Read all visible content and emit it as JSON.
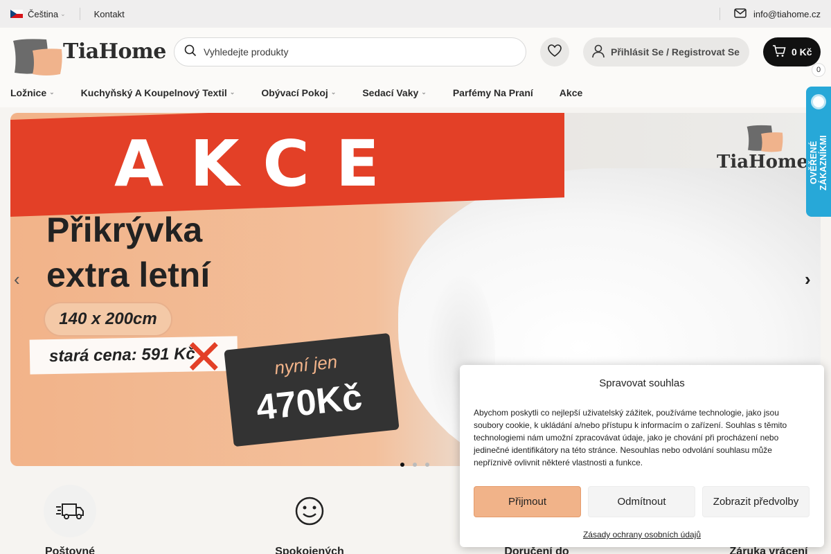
{
  "topbar": {
    "language": "Čeština",
    "contact": "Kontakt",
    "email": "info@tiahome.cz"
  },
  "header": {
    "logo_text": "TiaHome",
    "search_placeholder": "Vyhledejte produkty",
    "login_label": "Přihlásit Se / Registrovat Se",
    "cart_total": "0 Kč",
    "cart_count": "0"
  },
  "nav": {
    "items": [
      {
        "label": "Ložnice",
        "has_dropdown": true
      },
      {
        "label": "Kuchyňský A Koupelnový Textil",
        "has_dropdown": true
      },
      {
        "label": "Obývací Pokoj",
        "has_dropdown": true
      },
      {
        "label": "Sedací Vaky",
        "has_dropdown": true
      },
      {
        "label": "Parfémy Na Praní",
        "has_dropdown": false
      },
      {
        "label": "Akce",
        "has_dropdown": false
      }
    ]
  },
  "hero": {
    "headline": "AKCE",
    "title_line1": "Přikrývka",
    "title_line2": "extra letní",
    "size": "140 x 200cm",
    "old_price": "stará cena: 591 Kč",
    "new_price_label": "nyní jen",
    "new_price": "470Kč",
    "brand": "TiaHome",
    "slides": 3,
    "active_slide": 1
  },
  "side_badge": {
    "label": "OVĚŘENÉ ZÁKAZNÍKMI"
  },
  "features": [
    {
      "label": "Poštovné zdarma",
      "icon": "truck-icon"
    },
    {
      "label": "Spokojených",
      "icon": "smile-icon"
    },
    {
      "label": "Doručení do",
      "icon": ""
    },
    {
      "label": "Záruka vrácení",
      "icon": ""
    }
  ],
  "cookie": {
    "title": "Spravovat souhlas",
    "text": "Abychom poskytli co nejlepší uživatelský zážitek, používáme technologie, jako jsou soubory cookie, k ukládání a/nebo přístupu k informacím o zařízení. Souhlas s těmito technologiemi nám umožní zpracovávat údaje, jako je chování při procházení nebo jedinečné identifikátory na této stránce. Nesouhlas nebo odvolání souhlasu může nepříznivě ovlivnit některé vlastnosti a funkce.",
    "accept": "Přijmout",
    "reject": "Odmítnout",
    "preferences": "Zobrazit předvolby",
    "privacy_link": "Zásady ochrany osobních údajů"
  },
  "colors": {
    "accent": "#f1b389",
    "sale_red": "#e34027",
    "badge_blue": "#27a8d8",
    "cart_bg": "#111111"
  }
}
